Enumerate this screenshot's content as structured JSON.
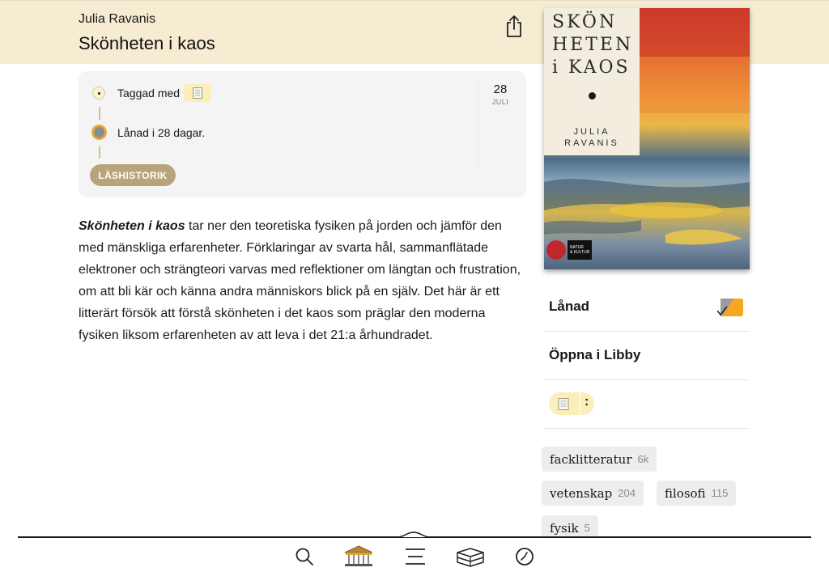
{
  "header": {
    "author": "Julia Ravanis",
    "title": "Skönheten i kaos",
    "share_icon": "share-icon"
  },
  "timeline": {
    "tagged_label": "Taggad med",
    "loan_text": "Lånad i 28 dagar.",
    "history_button": "LÄSHISTORIK",
    "date_day": "28",
    "date_month": "JULI"
  },
  "description": {
    "title": "Skönheten i kaos",
    "text": " tar ner den teoretiska fysiken på jorden och jämför den med mänskliga erfarenheter. Förklaringar av svarta hål, sammanflätade elektroner och strängteori varvas med reflektioner om längtan och frustra­tion, om att bli kär och känna andra människors blick på en själv. Det här är ett litterärt försök att förstå skönheten i det kaos som präglar den moderna fysiken liksom erfarenheten av att leva i det 21:a århundradet."
  },
  "cover": {
    "title": "SKÖN\nHETEN\ni KAOS",
    "author": "JULIA\nRAVANIS",
    "publisher": "NATUR\n& KULTUR"
  },
  "actions": {
    "loaned": "Lånad",
    "open_libby": "Öppna i Libby",
    "tag_menu": ":"
  },
  "subjects": [
    {
      "name": "facklitteratur",
      "count": "6k"
    },
    {
      "name": "vetenskap",
      "count": "204"
    },
    {
      "name": "filosofi",
      "count": "115"
    },
    {
      "name": "fysik",
      "count": "5"
    }
  ],
  "colors": {
    "header_bg": "#f6ecd2",
    "accent_gold": "#b8a47a",
    "tag_yellow": "#fbeeb8",
    "loan_orange": "#f5a623"
  }
}
